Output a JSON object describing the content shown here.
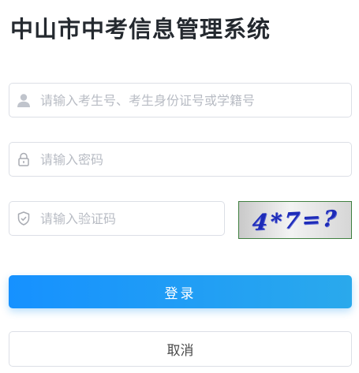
{
  "header": {
    "title": "中山市中考信息管理系统"
  },
  "form": {
    "username": {
      "placeholder": "请输入考生号、考生身份证号或学籍号",
      "value": "",
      "icon": "user-icon"
    },
    "password": {
      "placeholder": "请输入密码",
      "value": "",
      "icon": "lock-icon"
    },
    "captcha": {
      "placeholder": "请输入验证码",
      "value": "",
      "icon": "shield-icon",
      "image_text": "4*7=?"
    }
  },
  "buttons": {
    "login_label": "登录",
    "cancel_label": "取消"
  },
  "colors": {
    "accent": "#1691ff",
    "accent_end": "#2aa9ec",
    "border": "#dcdfe6",
    "placeholder": "#b8bcc4"
  }
}
